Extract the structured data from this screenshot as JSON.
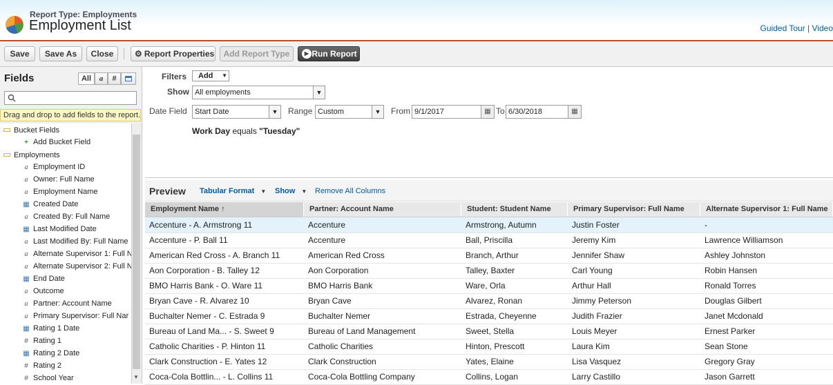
{
  "header": {
    "report_type": "Report Type: Employments",
    "title": "Employment List",
    "link_tour": "Guided Tour",
    "link_sep": "|",
    "link_video": "Video"
  },
  "toolbar": {
    "save": "Save",
    "save_as": "Save As",
    "close": "Close",
    "report_properties": "Report Properties",
    "add_report_type": "Add Report Type",
    "run_report": "Run Report"
  },
  "fields_panel": {
    "title": "Fields",
    "filter_all": "All",
    "filter_text": "a",
    "filter_num": "#",
    "drag_hint": "Drag and drop to add fields to the report.",
    "tree": [
      {
        "label": "Bucket Fields",
        "kind": "folder",
        "level": 0
      },
      {
        "label": "Add Bucket Field",
        "kind": "add",
        "level": 1
      },
      {
        "label": "Employments",
        "kind": "folder",
        "level": 0
      },
      {
        "label": "Employment ID",
        "kind": "text",
        "level": 1
      },
      {
        "label": "Owner: Full Name",
        "kind": "text",
        "level": 1
      },
      {
        "label": "Employment Name",
        "kind": "text",
        "level": 1
      },
      {
        "label": "Created Date",
        "kind": "date",
        "level": 1
      },
      {
        "label": "Created By: Full Name",
        "kind": "text",
        "level": 1
      },
      {
        "label": "Last Modified Date",
        "kind": "date",
        "level": 1
      },
      {
        "label": "Last Modified By: Full Name",
        "kind": "text",
        "level": 1
      },
      {
        "label": "Alternate Supervisor 1: Full N",
        "kind": "text",
        "level": 1
      },
      {
        "label": "Alternate Supervisor 2: Full N",
        "kind": "text",
        "level": 1
      },
      {
        "label": "End Date",
        "kind": "date",
        "level": 1
      },
      {
        "label": "Outcome",
        "kind": "text",
        "level": 1
      },
      {
        "label": "Partner: Account Name",
        "kind": "text",
        "level": 1
      },
      {
        "label": "Primary Supervisor: Full Nar",
        "kind": "text",
        "level": 1
      },
      {
        "label": "Rating 1 Date",
        "kind": "date",
        "level": 1
      },
      {
        "label": "Rating 1",
        "kind": "num",
        "level": 1
      },
      {
        "label": "Rating 2 Date",
        "kind": "date",
        "level": 1
      },
      {
        "label": "Rating 2",
        "kind": "num",
        "level": 1
      },
      {
        "label": "School Year",
        "kind": "num",
        "level": 1
      }
    ]
  },
  "filters": {
    "filters_label": "Filters",
    "add_label": "Add",
    "show_label": "Show",
    "show_value": "All employments",
    "date_field_label": "Date Field",
    "date_field_value": "Start Date",
    "range_label": "Range",
    "range_value": "Custom",
    "from_label": "From",
    "from_value": "9/1/2017",
    "to_label": "To",
    "to_value": "6/30/2018",
    "criteria_field": "Work Day",
    "criteria_op": " equals ",
    "criteria_value": "\"Tuesday\""
  },
  "preview": {
    "title": "Preview",
    "format": "Tabular Format",
    "show": "Show",
    "remove_all": "Remove All Columns"
  },
  "table": {
    "columns": [
      "Employment Name ↑",
      "Partner: Account Name",
      "Student: Student Name",
      "Primary Supervisor: Full Name",
      "Alternate Supervisor 1: Full Name"
    ],
    "rows": [
      [
        "Accenture - A. Armstrong 11",
        "Accenture",
        "Armstrong, Autumn",
        "Justin Foster",
        "-"
      ],
      [
        "Accenture - P. Ball 11",
        "Accenture",
        "Ball, Priscilla",
        "Jeremy Kim",
        "Lawrence Williamson"
      ],
      [
        "American Red Cross - A. Branch 11",
        "American Red Cross",
        "Branch, Arthur",
        "Jennifer Shaw",
        "Ashley Johnston"
      ],
      [
        "Aon Corporation - B. Talley 12",
        "Aon Corporation",
        "Talley, Baxter",
        "Carl Young",
        "Robin Hansen"
      ],
      [
        "BMO Harris Bank - O. Ware 11",
        "BMO Harris Bank",
        "Ware, Orla",
        "Arthur Hall",
        "Ronald Torres"
      ],
      [
        "Bryan Cave - R. Alvarez 10",
        "Bryan Cave",
        "Alvarez, Ronan",
        "Jimmy Peterson",
        "Douglas Gilbert"
      ],
      [
        "Buchalter Nemer - C. Estrada 9",
        "Buchalter Nemer",
        "Estrada, Cheyenne",
        "Judith Frazier",
        "Janet Mcdonald"
      ],
      [
        "Bureau of Land Ma... - S. Sweet 9",
        "Bureau of Land Management",
        "Sweet, Stella",
        "Louis Meyer",
        "Ernest Parker"
      ],
      [
        "Catholic Charities - P. Hinton 11",
        "Catholic Charities",
        "Hinton, Prescott",
        "Laura Kim",
        "Sean Stone"
      ],
      [
        "Clark Construction - E. Yates 12",
        "Clark Construction",
        "Yates, Elaine",
        "Lisa Vasquez",
        "Gregory Gray"
      ],
      [
        "Coca-Cola Bottlin... - L. Collins 11",
        "Coca-Cola Bottling Company",
        "Collins, Logan",
        "Larry Castillo",
        "Jason Garrett"
      ]
    ]
  }
}
